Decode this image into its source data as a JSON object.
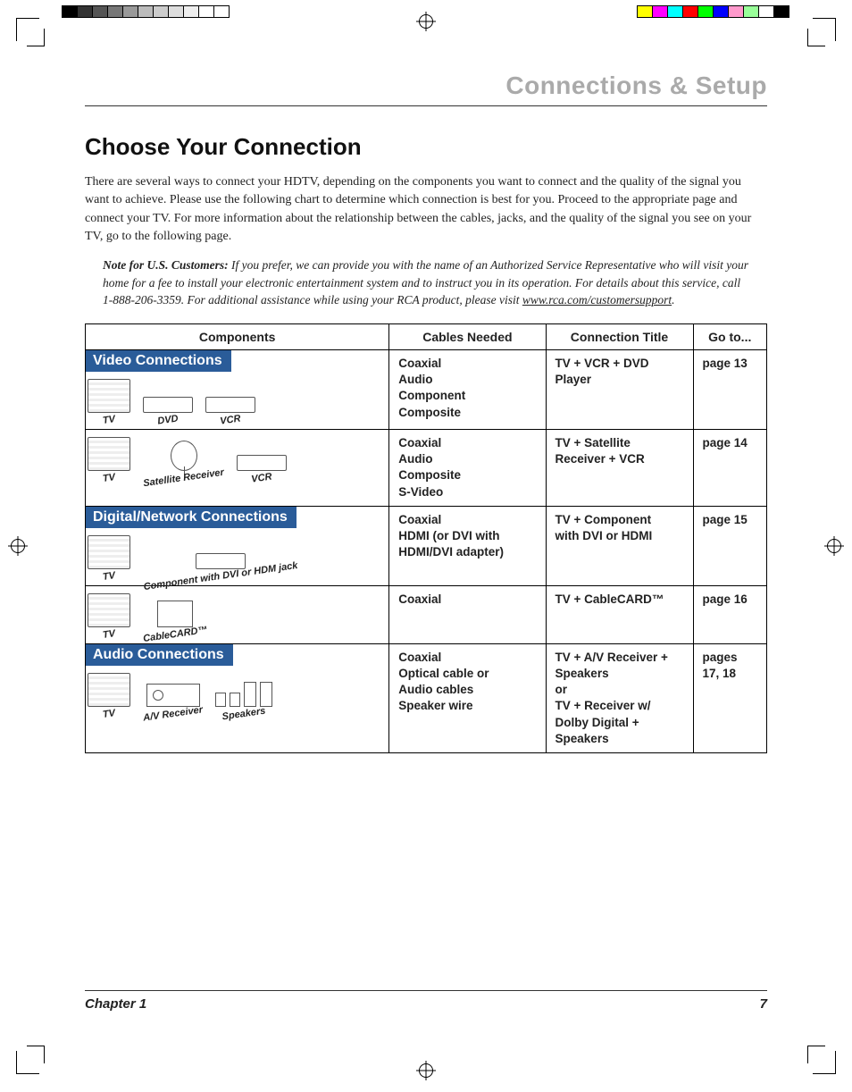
{
  "header": {
    "chapter_title": "Connections & Setup"
  },
  "section": {
    "title": "Choose Your Connection",
    "intro": "There are several ways to connect your HDTV, depending on the components you want to connect and the quality of the signal you want to achieve. Please use the following chart to determine which connection is best for you. Proceed to the appropriate page and connect your TV. For more information about the relationship between the cables, jacks, and the quality of the signal you see on your TV, go to the following page."
  },
  "note": {
    "label": "Note for U.S. Customers:",
    "body": " If you prefer, we can provide you with the name of an Authorized Service Representative who will visit your home for a fee to install your electronic entertainment system and to instruct you in its operation. For details about this service, call 1-888-206-3359. For additional assistance while using your RCA product, please visit ",
    "link": "www.rca.com/customersupport",
    "tail": "."
  },
  "table": {
    "headers": {
      "components": "Components",
      "cables": "Cables Needed",
      "title": "Connection Title",
      "goto": "Go to..."
    },
    "sections": [
      {
        "label": "Video Connections",
        "rows": [
          {
            "devices": [
              {
                "kind": "tv",
                "label": "TV"
              },
              {
                "kind": "box",
                "label": "DVD"
              },
              {
                "kind": "box",
                "label": "VCR"
              }
            ],
            "cables": [
              "Coaxial",
              "Audio",
              "Component",
              "Composite"
            ],
            "title": [
              "TV +  VCR + DVD",
              "Player"
            ],
            "goto": "page 13"
          },
          {
            "devices": [
              {
                "kind": "tv",
                "label": "TV"
              },
              {
                "kind": "dish",
                "label": "Satellite Receiver"
              },
              {
                "kind": "box",
                "label": "VCR"
              }
            ],
            "cables": [
              "Coaxial",
              "Audio",
              "Composite",
              "S-Video"
            ],
            "title": [
              "TV + Satellite",
              "Receiver + VCR"
            ],
            "goto": "page 14"
          }
        ]
      },
      {
        "label": "Digital/Network Connections",
        "rows": [
          {
            "devices": [
              {
                "kind": "tv",
                "label": "TV"
              },
              {
                "kind": "box",
                "label": "Component with DVI or HDM jack"
              }
            ],
            "cables": [
              "Coaxial",
              "HDMI (or DVI with",
              "HDMI/DVI adapter)"
            ],
            "title": [
              "TV + Component",
              "with DVI or HDMI"
            ],
            "goto": "page 15"
          },
          {
            "devices": [
              {
                "kind": "tv",
                "label": "TV"
              },
              {
                "kind": "card",
                "label": "CableCARD™"
              }
            ],
            "cables": [
              "Coaxial"
            ],
            "title": [
              "TV + CableCARD™"
            ],
            "goto": "page 16"
          }
        ]
      },
      {
        "label": "Audio Connections",
        "rows": [
          {
            "devices": [
              {
                "kind": "tv",
                "label": "TV"
              },
              {
                "kind": "recv",
                "label": "A/V Receiver"
              },
              {
                "kind": "spk",
                "label": "Speakers"
              }
            ],
            "cables": [
              "Coaxial",
              "Optical cable or",
              "Audio cables",
              "Speaker wire"
            ],
            "title": [
              "TV + A/V Receiver +",
              "Speakers",
              "or",
              "TV + Receiver w/",
              "Dolby Digital +",
              "Speakers"
            ],
            "goto": "pages 17, 18"
          }
        ]
      }
    ]
  },
  "footer": {
    "chapter": "Chapter 1",
    "page": "7"
  },
  "colorbars": {
    "left": [
      "#000",
      "#333",
      "#555",
      "#777",
      "#999",
      "#bbb",
      "#ccc",
      "#ddd",
      "#eee",
      "#fff",
      "#fff"
    ],
    "right": [
      "#ff0",
      "#f0f",
      "#0ff",
      "#f00",
      "#0f0",
      "#00f",
      "#f9c",
      "#9f9",
      "#fff",
      "#000"
    ]
  }
}
